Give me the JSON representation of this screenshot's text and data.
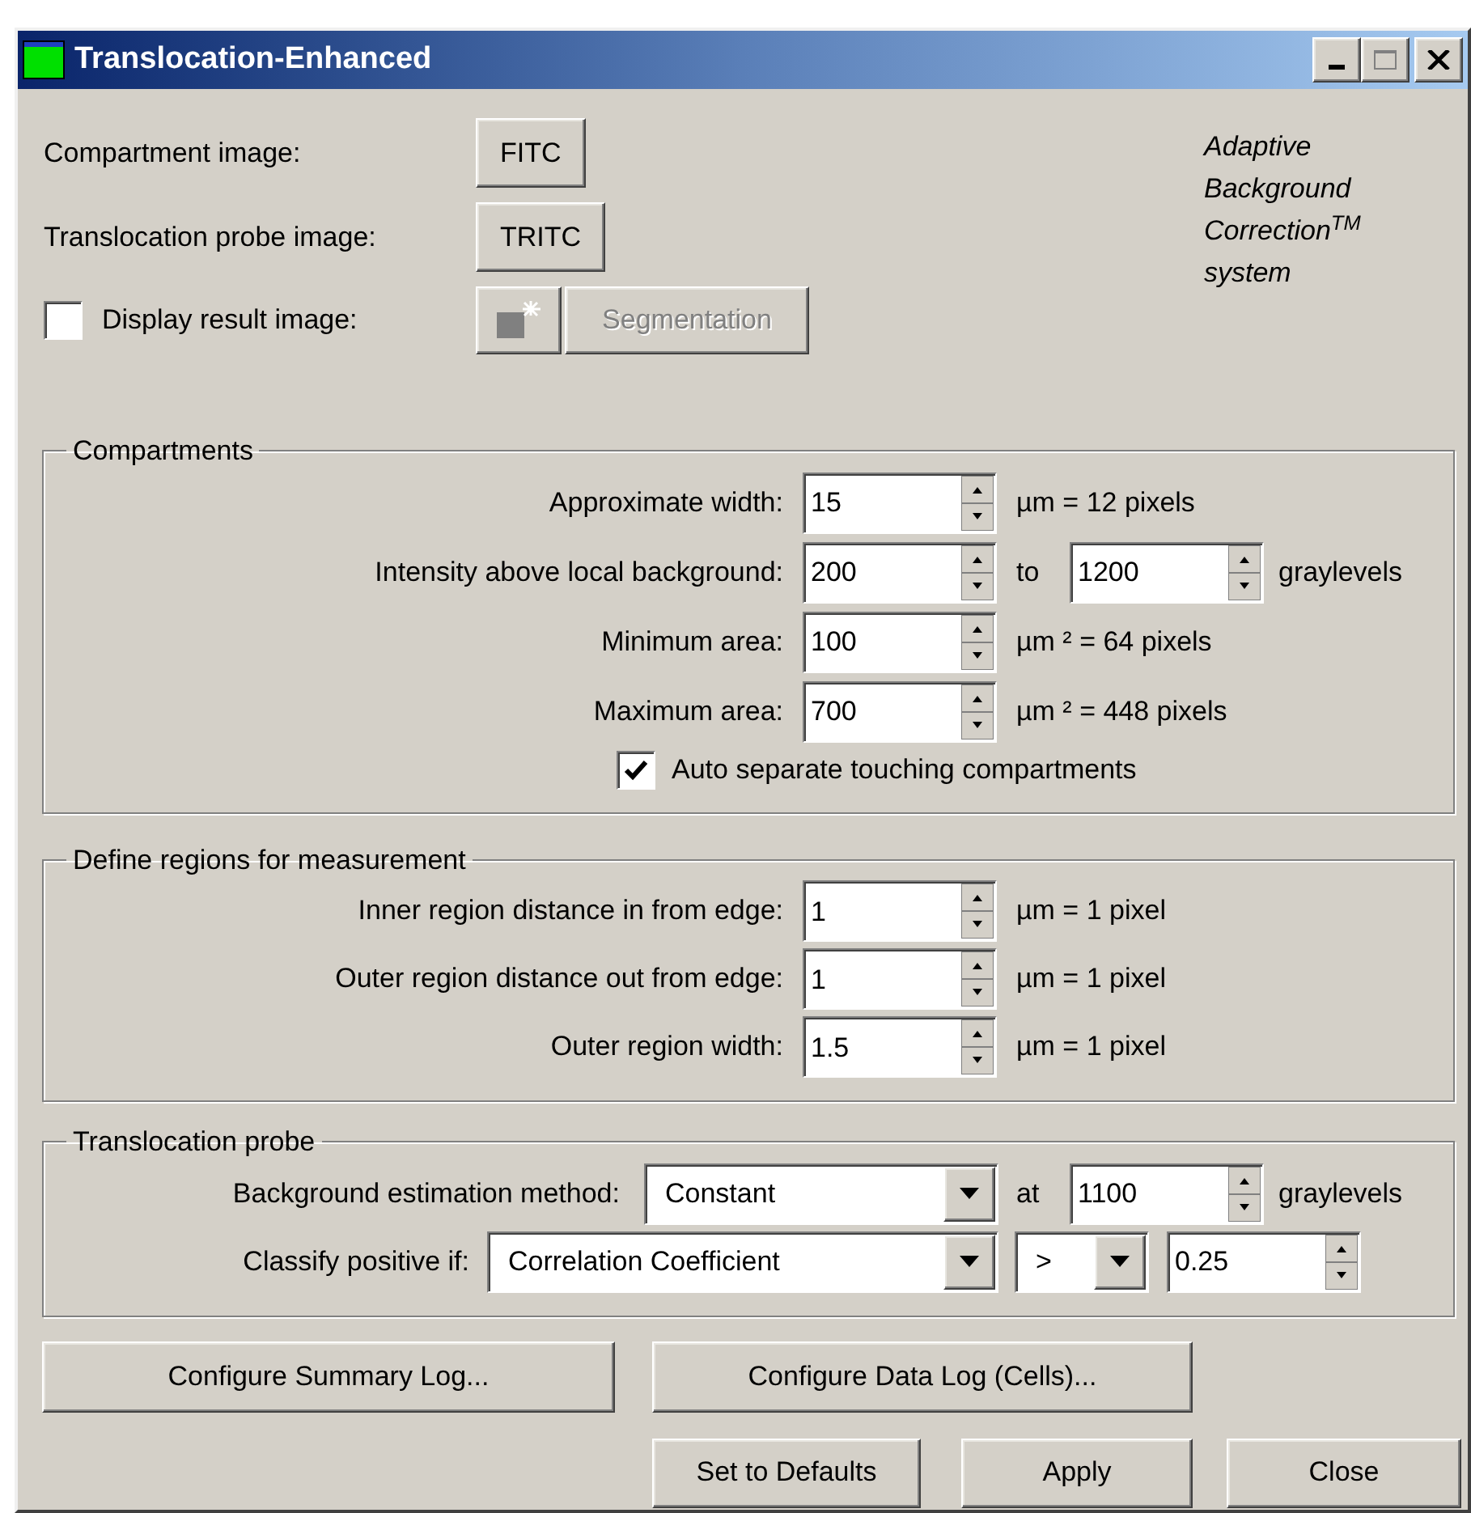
{
  "window": {
    "title": "Translocation-Enhanced"
  },
  "images": [
    {
      "label": "Compartment image:",
      "button": "FITC"
    },
    {
      "label": "Translocation probe image:",
      "button": "TRITC"
    }
  ],
  "display_result": {
    "label": "Display result image:",
    "checked": false,
    "button": "Segmentation",
    "disabled": true
  },
  "branding": [
    "Adaptive",
    "Background",
    "Correction$^{TM}$",
    "system"
  ],
  "groups": [
    {
      "title": "Compartments",
      "rows": [
        {
          "kind": "spin",
          "label": "Approximate width:",
          "value": "15",
          "unit": "µm = 12 pixels"
        },
        {
          "kind": "range",
          "label": "Intensity above local background:",
          "value": "200",
          "to": "to",
          "value2": "1200",
          "unit": "graylevels"
        },
        {
          "kind": "spin",
          "label": "Minimum area:",
          "value": "100",
          "unit": "µm ² = 64 pixels"
        },
        {
          "kind": "spin",
          "label": "Maximum area:",
          "value": "700",
          "unit": "µm ² = 448 pixels"
        },
        {
          "kind": "check",
          "label": "Auto separate touching compartments",
          "checked": true
        }
      ]
    },
    {
      "title": "Define regions for measurement",
      "rows": [
        {
          "kind": "spin",
          "label": "Inner region distance in from edge:",
          "value": "1",
          "unit": "µm = 1 pixel"
        },
        {
          "kind": "spin",
          "label": "Outer region distance out from edge:",
          "value": "1",
          "unit": "µm = 1 pixel"
        },
        {
          "kind": "spin",
          "label": "Outer region width:",
          "value": "1.5",
          "unit": "µm = 1 pixel"
        }
      ]
    },
    {
      "title": "Translocation probe",
      "rows": [
        {
          "kind": "select",
          "label": "Background estimation method:",
          "select": "Constant",
          "at": "at",
          "value": "1100",
          "unit": "graylevels"
        },
        {
          "kind": "classify",
          "label": "Classify positive if:",
          "select": "Correlation Coefficient",
          "operator": ">",
          "value": "0.25"
        }
      ]
    }
  ],
  "log_buttons": [
    "Configure Summary Log...",
    "Configure Data Log (Cells)..."
  ],
  "action_buttons": [
    "Set to Defaults",
    "Apply",
    "Close"
  ]
}
